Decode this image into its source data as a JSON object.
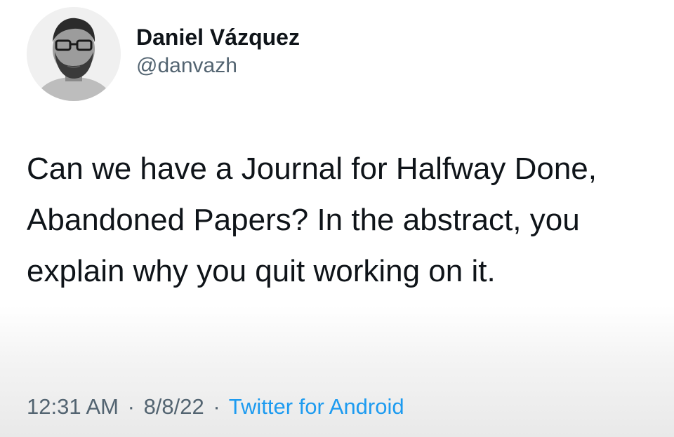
{
  "author": {
    "display_name": "Daniel Vázquez",
    "handle": "@danvazh"
  },
  "tweet": {
    "text": "Can we have a Journal for Halfway Done, Abandoned Papers? In the abstract, you explain why you quit working on it."
  },
  "meta": {
    "time": "12:31 AM",
    "separator": "·",
    "date": "8/8/22",
    "source": "Twitter for Android"
  },
  "colors": {
    "text": "#0f1419",
    "secondary": "#536471",
    "link": "#1d9bf0"
  }
}
